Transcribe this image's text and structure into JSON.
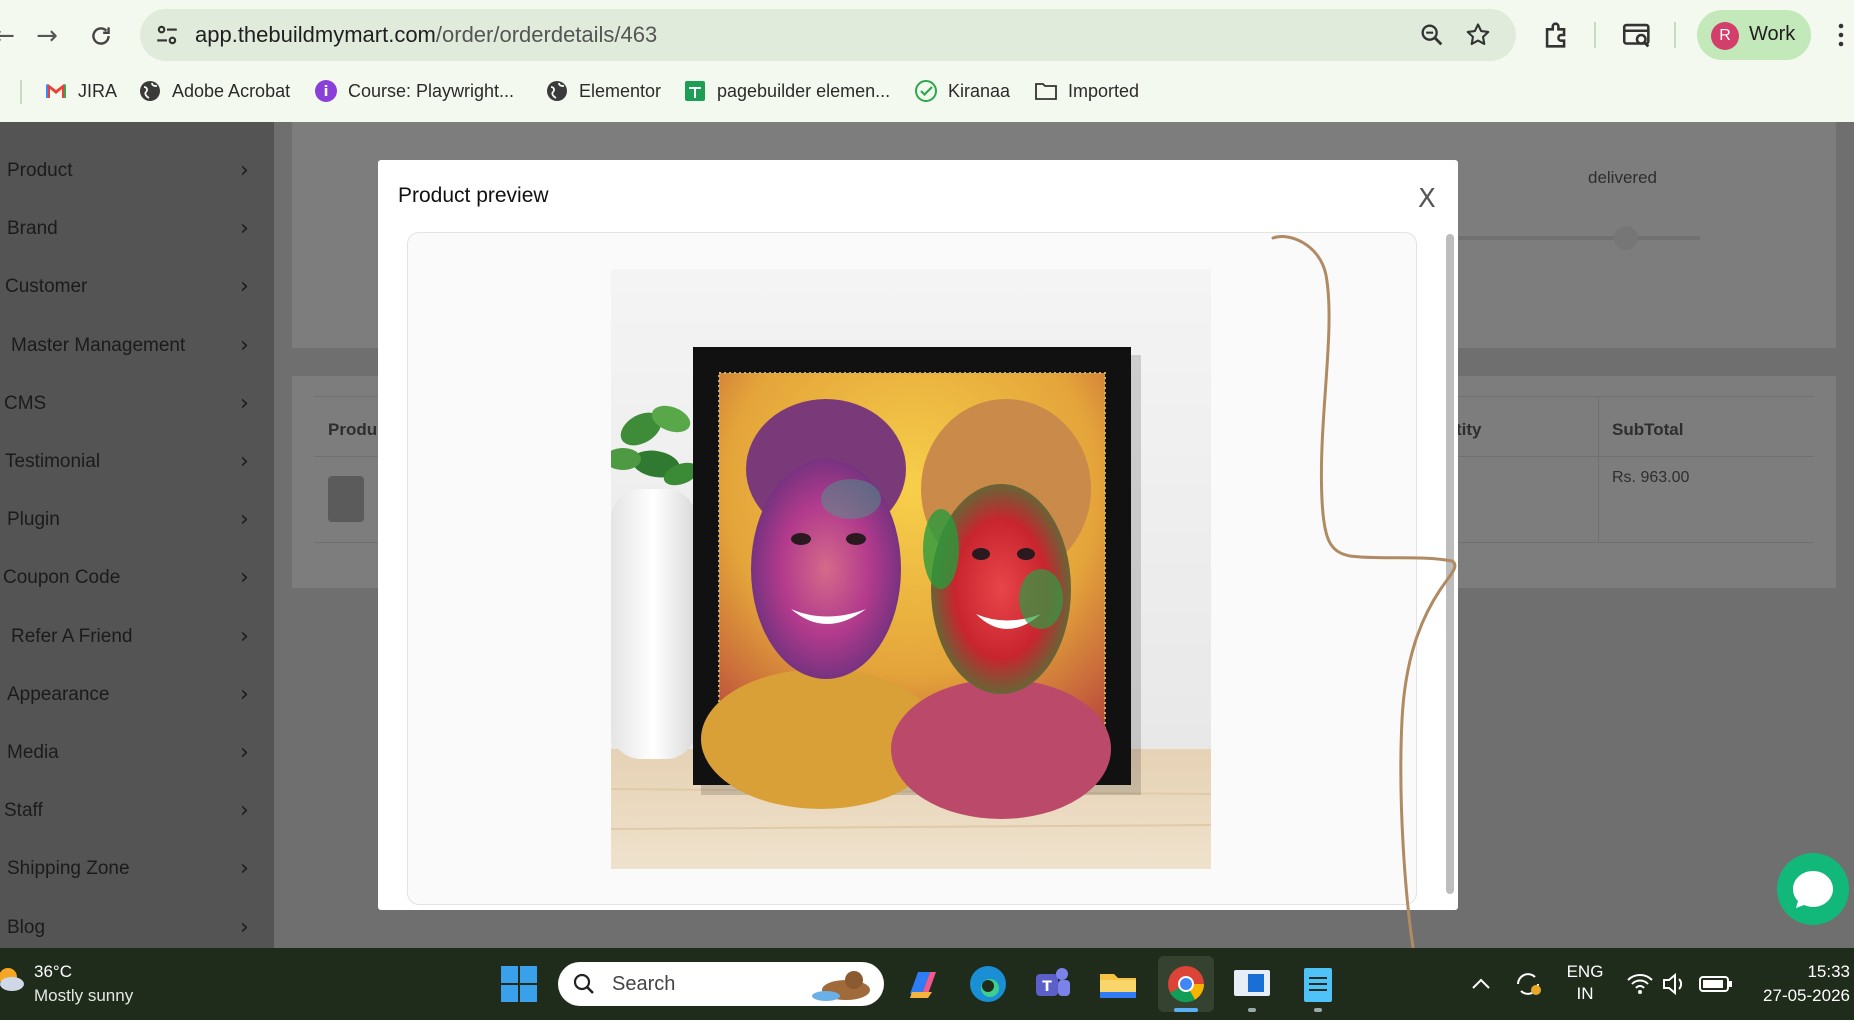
{
  "browser": {
    "url_domain": "app.thebuildmymart.com",
    "url_path": "/order/orderdetails/463",
    "profile_initial": "R",
    "profile_label": "Work"
  },
  "bookmarks": [
    "JIRA",
    "Adobe Acrobat",
    "Course: Playwright...",
    "Elementor",
    "pagebuilder elemen...",
    "Kiranaa",
    "Imported"
  ],
  "sidebar": {
    "items": [
      "Product",
      "Brand",
      "Customer",
      "Master Management",
      "CMS",
      "Testimonial",
      "Plugin",
      "Coupon Code",
      "Refer A Friend",
      "Appearance",
      "Media",
      "Staff",
      "Shipping Zone",
      "Blog"
    ]
  },
  "background": {
    "status_delivered": "delivered",
    "col_product": "Produ",
    "col_quantity": "tity",
    "col_subtotal": "SubTotal",
    "subtotal_value": "Rs. 963.00"
  },
  "modal": {
    "title": "Product preview",
    "close_label": "X"
  },
  "taskbar": {
    "temperature": "36°C",
    "weather": "Mostly sunny",
    "search_placeholder": "Search",
    "lang_1": "ENG",
    "lang_2": "IN",
    "time": "15:33",
    "date": "27-05-2026"
  },
  "colors": {
    "modal_bg": "#ffffff",
    "overlay": "#6f6f6f",
    "chat_accent": "#12b87a",
    "annotation_stroke": "#b08a63"
  }
}
